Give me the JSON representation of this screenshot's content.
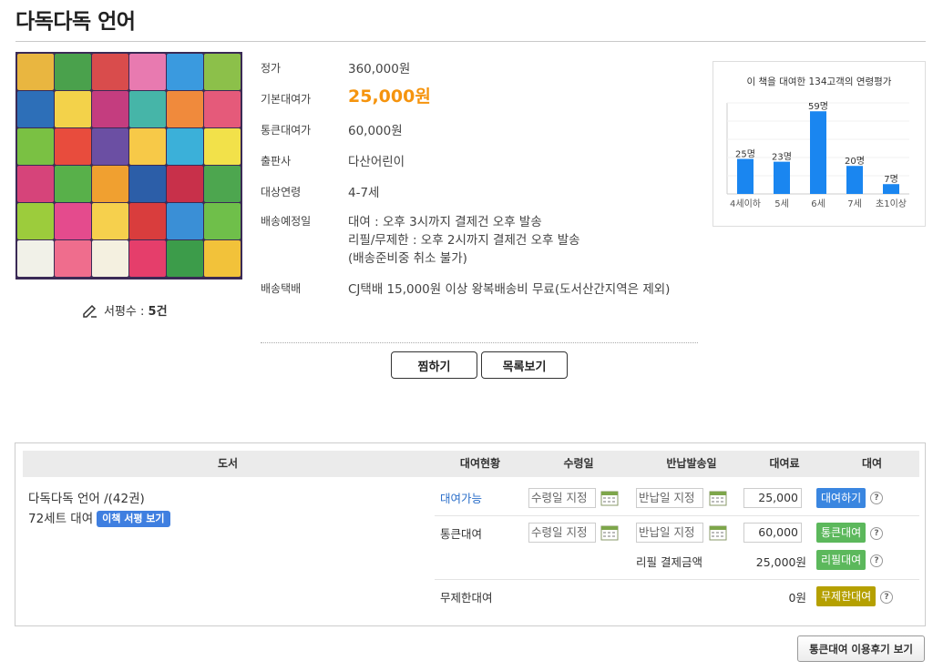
{
  "title": "다독다독 언어",
  "review": {
    "label": "서평수 : ",
    "count": "5건"
  },
  "info": {
    "price_label": "정가",
    "price": "360,000원",
    "base_rent_label": "기본대여가",
    "base_rent": "25,000원",
    "bulk_rent_label": "통큰대여가",
    "bulk_rent": "60,000원",
    "publisher_label": "출판사",
    "publisher": "다산어린이",
    "age_label": "대상연령",
    "age": "4-7세",
    "ship_date_label": "배송예정일",
    "ship_date_1": "대여 : 오후 3시까지 결제건 오후 발송",
    "ship_date_2": "리필/무제한 : 오후 2시까지 결제건 오후 발송",
    "ship_date_3": "(배송준비중 취소 불가)",
    "courier_label": "배송택배",
    "courier": "CJ택배 15,000원 이상 왕복배송비 무료(도서산간지역은 제외)"
  },
  "buttons": {
    "wish": "찜하기",
    "list": "목록보기",
    "bulk_review": "통큰대여 이용후기 보기"
  },
  "chart_data": {
    "type": "bar",
    "title": "이 책을 대여한 134고객의 연령평가",
    "categories": [
      "4세이하",
      "5세",
      "6세",
      "7세",
      "초1이상"
    ],
    "values": [
      25,
      23,
      59,
      20,
      7
    ],
    "value_labels": [
      "25명",
      "23명",
      "59명",
      "20명",
      "7명"
    ],
    "ylim": [
      0,
      65
    ],
    "grid": true,
    "color": "#1a86f0"
  },
  "table": {
    "headers": {
      "book": "도서",
      "status": "대여현황",
      "receive": "수령일",
      "return": "반납발송일",
      "fee": "대여료",
      "rent": "대여"
    },
    "book_name": "다독다독 언어 /(42권)",
    "set_info": "72세트 대여",
    "review_tag": "이책 서평 보기",
    "rows": [
      {
        "status": "대여가능",
        "receive_ph": "수령일 지정",
        "return_ph": "반납일 지정",
        "fee": "25,000",
        "action": "대여하기",
        "action_color": "#3a86e0"
      },
      {
        "status": "통큰대여",
        "receive_ph": "수령일 지정",
        "return_ph": "반납일 지정",
        "fee": "60,000",
        "action": "통큰대여",
        "action_color": "#5cb85c"
      },
      {
        "refill_label": "리필 결제금액",
        "refill_amount": "25,000원",
        "action": "리필대여",
        "action_color": "#5cb85c"
      },
      {
        "status": "무제한대여",
        "amount": "0원",
        "action": "무제한대여",
        "action_color": "#b5a000"
      }
    ],
    "help": "?"
  }
}
